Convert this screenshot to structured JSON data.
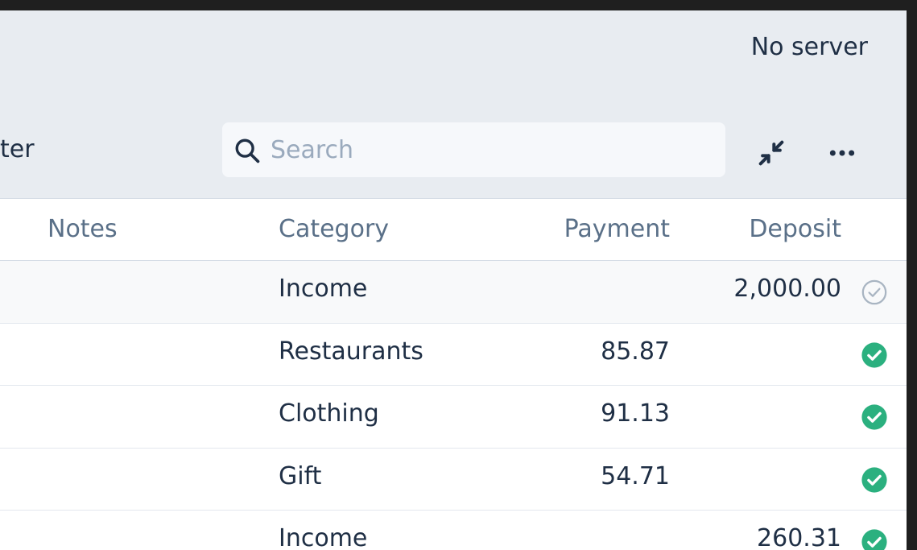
{
  "header": {
    "server_status": "No server",
    "filter_fragment": "ter"
  },
  "search": {
    "placeholder": "Search",
    "value": ""
  },
  "icons": {
    "search": "search-icon",
    "collapse": "collapse-arrows-icon",
    "more": "more-horizontal-icon",
    "cleared": "check-circle-icon",
    "uncleared": "check-circle-outline-icon"
  },
  "colors": {
    "accent_green": "#2bb07f",
    "muted_gray": "#a9b5c2",
    "text_dark": "#1f2f45",
    "header_text": "#5a7088"
  },
  "table": {
    "columns": {
      "notes": "Notes",
      "category": "Category",
      "payment": "Payment",
      "deposit": "Deposit"
    },
    "rows": [
      {
        "category": "Income",
        "payment": "",
        "deposit": "2,000.00",
        "cleared": false
      },
      {
        "category": "Restaurants",
        "payment": "85.87",
        "deposit": "",
        "cleared": true
      },
      {
        "category": "Clothing",
        "payment": "91.13",
        "deposit": "",
        "cleared": true
      },
      {
        "category": "Gift",
        "payment": "54.71",
        "deposit": "",
        "cleared": true
      },
      {
        "category": "Income",
        "payment": "",
        "deposit": "260.31",
        "cleared": true
      }
    ]
  }
}
